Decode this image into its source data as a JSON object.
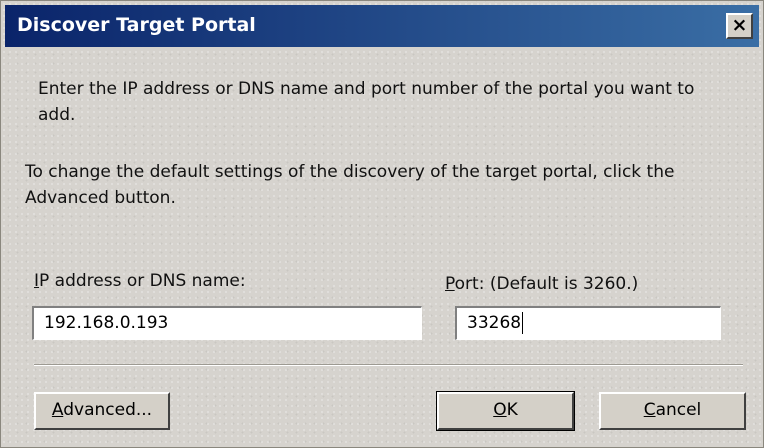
{
  "window": {
    "title": "Discover Target Portal",
    "close_glyph": "×"
  },
  "instructions": {
    "line1": "Enter the IP address or DNS name and port number of the portal you want to add.",
    "line2": "To change the default settings of the discovery of the target portal, click the Advanced button."
  },
  "fields": {
    "ip_label_accel": "I",
    "ip_label_rest": "P address or DNS name:",
    "ip_value": "192.168.0.193",
    "port_label_accel": "P",
    "port_label_rest": "ort: (Default is 3260.)",
    "port_value": "33268"
  },
  "buttons": {
    "advanced_accel": "A",
    "advanced_rest": "dvanced...",
    "ok_accel": "O",
    "ok_rest": "K",
    "cancel_accel": "C",
    "cancel_rest": "ancel"
  }
}
